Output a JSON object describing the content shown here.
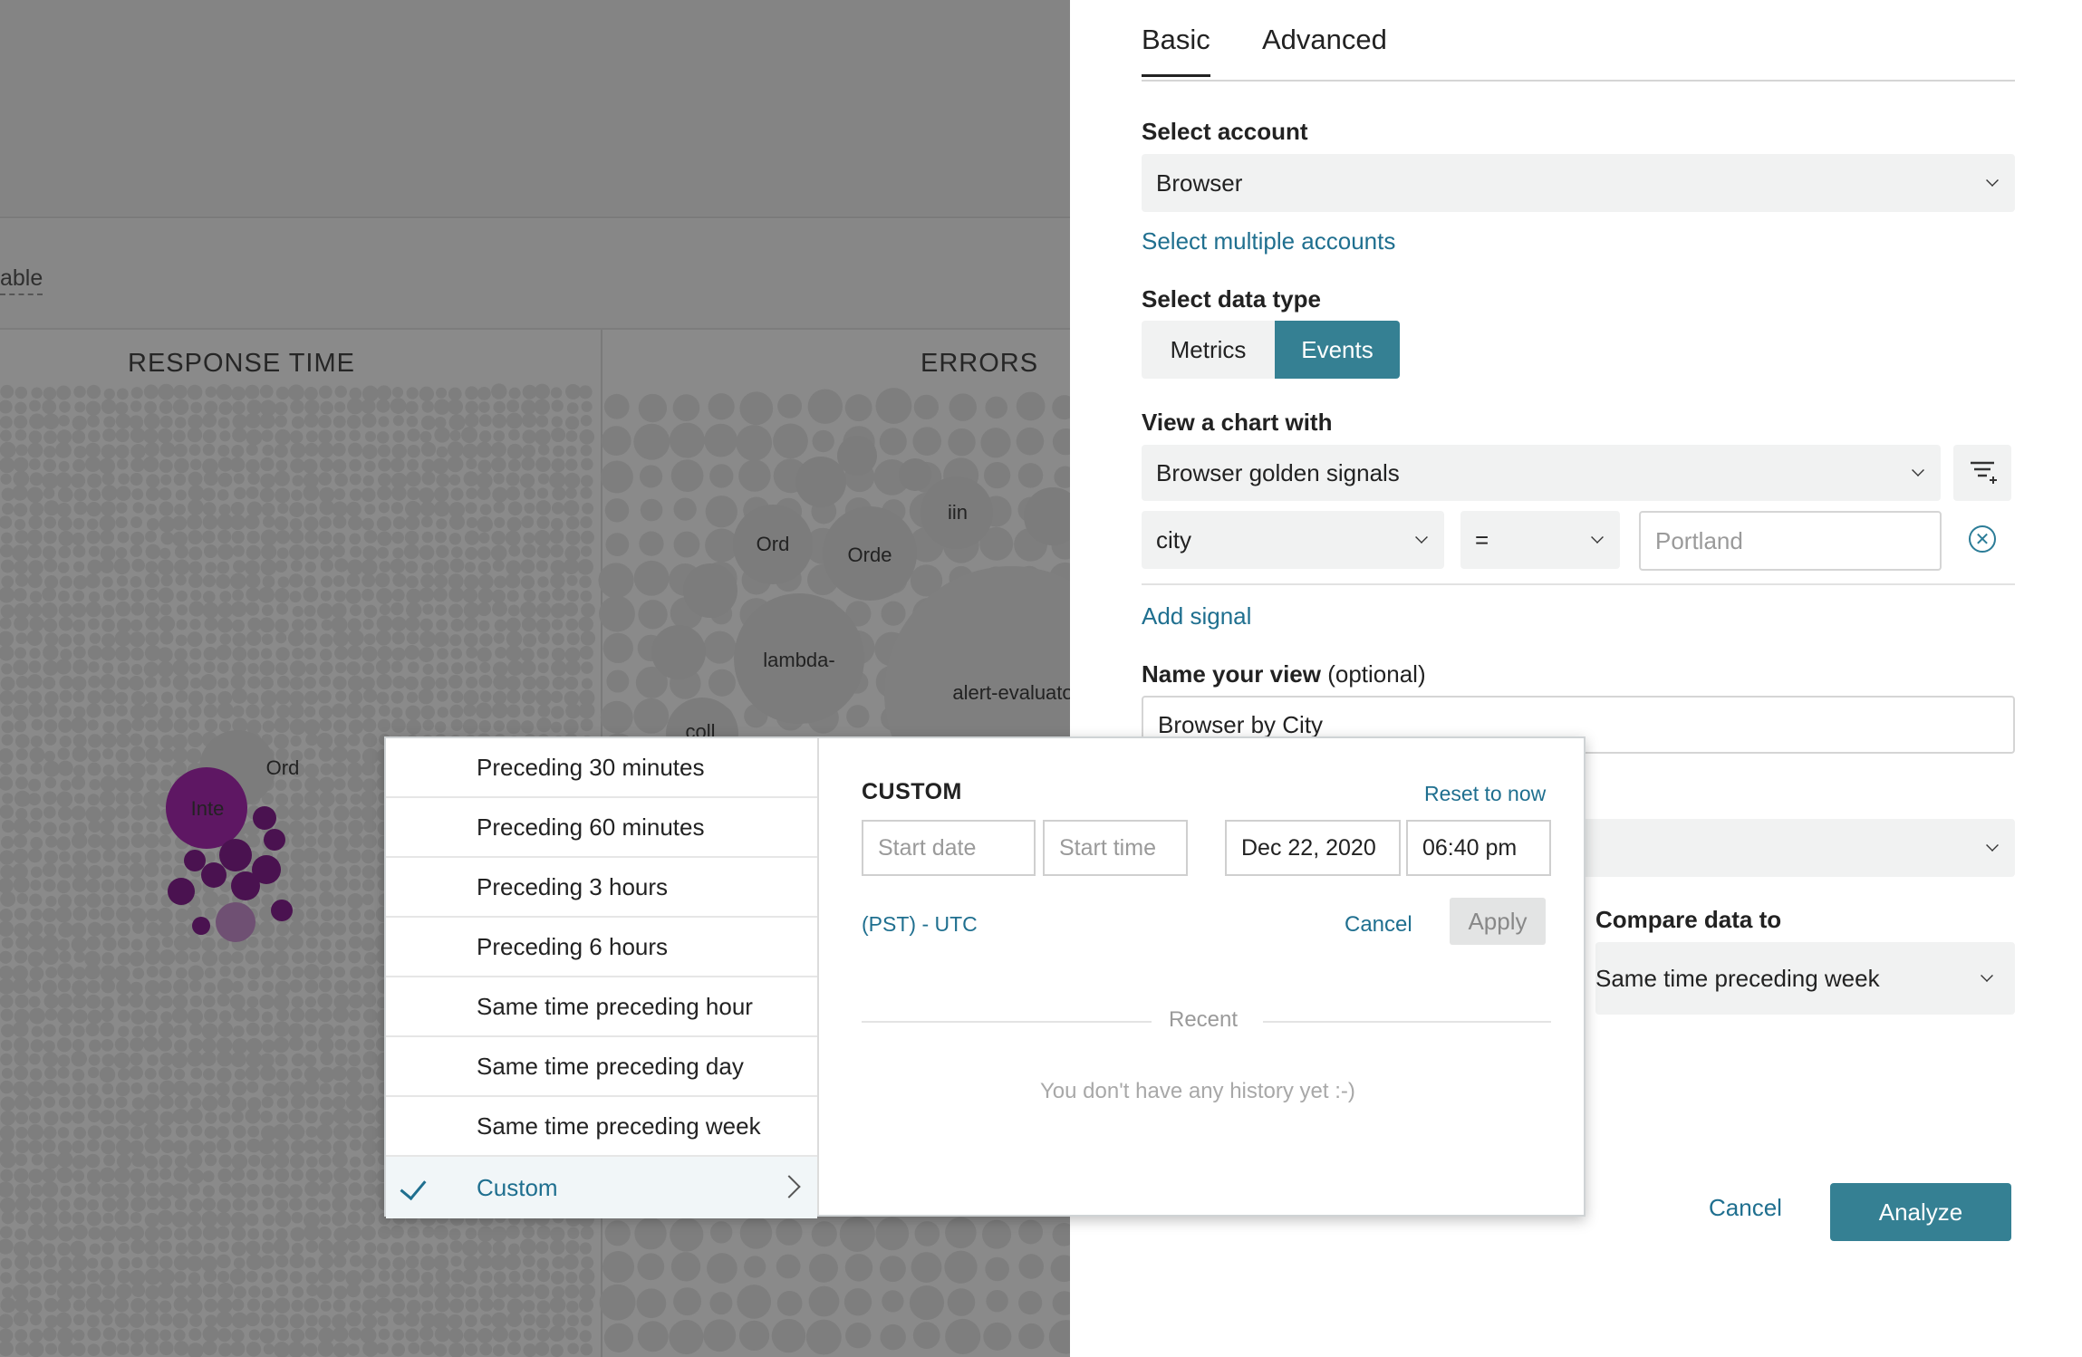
{
  "background": {
    "filter_label": "able",
    "columns": [
      {
        "title": "RESPONSE TIME"
      },
      {
        "title": "ERRORS"
      }
    ],
    "bubble_labels": [
      "Ord",
      "Inte",
      "Ord",
      "Orde",
      "iin",
      "lambda-",
      "alert-evaluato",
      "coll"
    ]
  },
  "tabs": {
    "basic": "Basic",
    "advanced": "Advanced"
  },
  "account": {
    "label": "Select account",
    "value": "Browser",
    "multi_link": "Select multiple accounts"
  },
  "data_type": {
    "label": "Select data type",
    "options": [
      "Metrics",
      "Events"
    ],
    "selected": "Events"
  },
  "chart": {
    "label": "View a chart with",
    "value": "Browser golden signals",
    "filter_icon": "filter-add-icon"
  },
  "filter_row": {
    "attribute": "city",
    "operator": "=",
    "value_placeholder": "Portland",
    "clear_icon": "clear-circle-icon"
  },
  "add_signal": "Add signal",
  "view_name": {
    "label": "Name your view",
    "optional": "(optional)",
    "value": "Browser by City"
  },
  "compare": {
    "label": "Compare data to",
    "value": "Same time preceding week"
  },
  "footer": {
    "cancel": "Cancel",
    "analyze": "Analyze"
  },
  "popover": {
    "presets": [
      "Preceding 30 minutes",
      "Preceding 60 minutes",
      "Preceding 3 hours",
      "Preceding 6 hours",
      "Same time preceding hour",
      "Same time preceding day",
      "Same time preceding week",
      "Custom"
    ],
    "selected": "Custom",
    "custom_title": "CUSTOM",
    "reset": "Reset to now",
    "start_date_placeholder": "Start date",
    "start_time_placeholder": "Start time",
    "end_date": "Dec 22, 2020",
    "end_time": "06:40 pm",
    "timezone": "(PST) - UTC",
    "cancel": "Cancel",
    "apply": "Apply",
    "recent": "Recent",
    "no_history": "You don't have any history yet :-)"
  },
  "colors": {
    "accent": "#358093",
    "link": "#1f6f8f",
    "highlight_bubble": "#5e1763"
  }
}
